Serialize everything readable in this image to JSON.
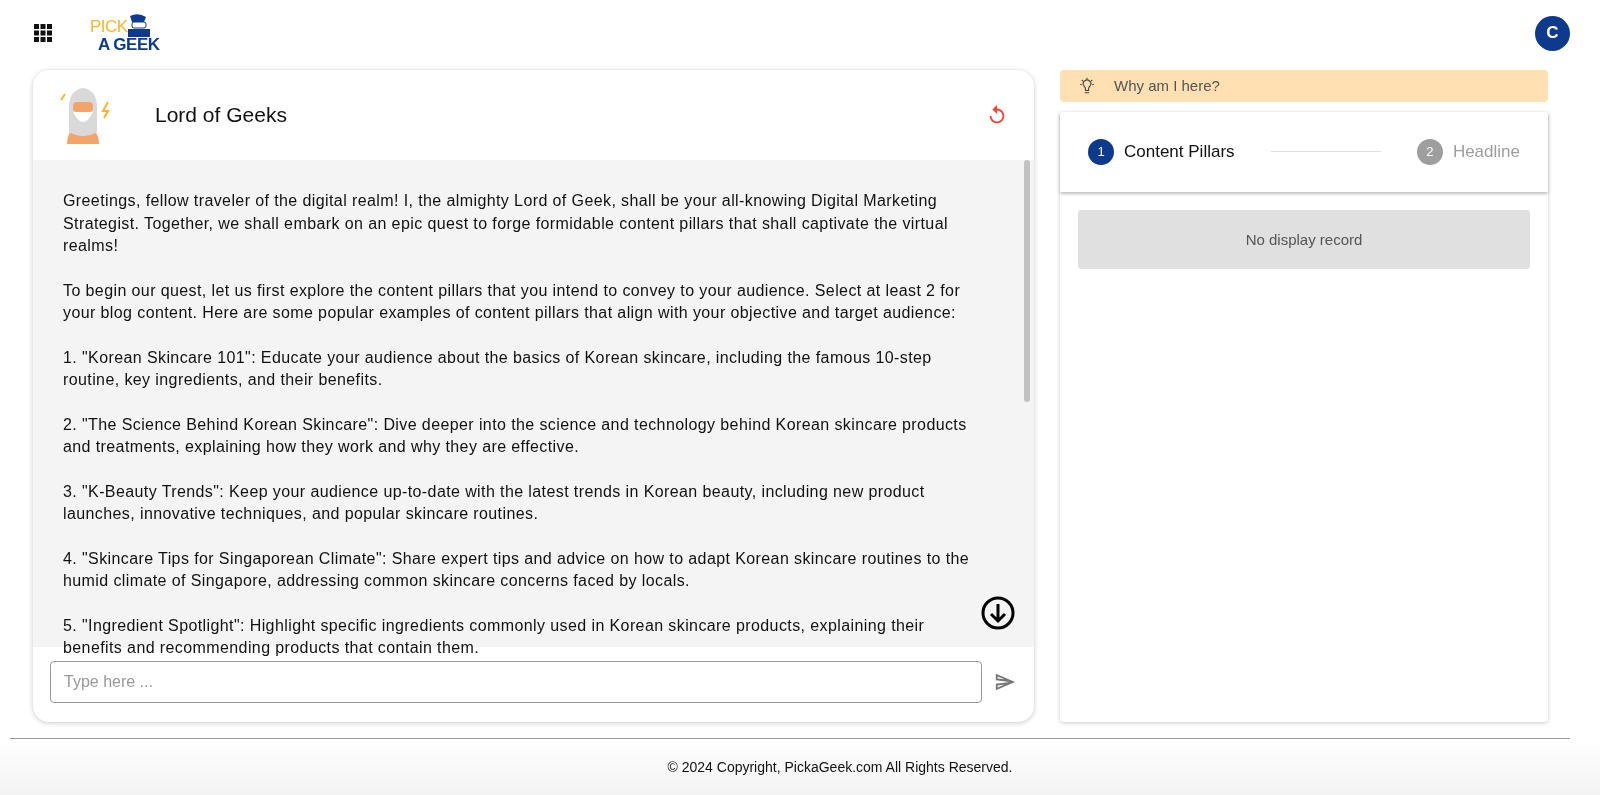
{
  "header": {
    "logo": {
      "line1": "PICK",
      "line2": "A GEEK"
    },
    "avatar": "C"
  },
  "chat": {
    "title": "Lord of Geeks",
    "messages": [
      "Greetings, fellow traveler of the digital realm! I, the almighty Lord of Geek, shall be your all-knowing Digital Marketing Strategist. Together, we shall embark on an epic quest to forge formidable content pillars that shall captivate the virtual realms!",
      "To begin our quest, let us first explore the content pillars that you intend to convey to your audience. Select at least 2 for your blog content. Here are some popular examples of content pillars that align with your objective and target audience:",
      "1. \"Korean Skincare 101\": Educate your audience about the basics of Korean skincare, including the famous 10-step routine, key ingredients, and their benefits.",
      "2. \"The Science Behind Korean Skincare\": Dive deeper into the science and technology behind Korean skincare products and treatments, explaining how they work and why they are effective.",
      "3. \"K-Beauty Trends\": Keep your audience up-to-date with the latest trends in Korean beauty, including new product launches, innovative techniques, and popular skincare routines.",
      "4. \"Skincare Tips for Singaporean Climate\": Share expert tips and advice on how to adapt Korean skincare routines to the humid climate of Singapore, addressing common skincare concerns faced by locals.",
      "5. \"Ingredient Spotlight\": Highlight specific ingredients commonly used in Korean skincare products, explaining their benefits and recommending products that contain them."
    ],
    "input": {
      "placeholder": "Type here ..."
    }
  },
  "help_banner": "Why am I here?",
  "stepper": [
    {
      "number": "1",
      "label": "Content Pillars",
      "selected": true
    },
    {
      "number": "2",
      "label": "Headline",
      "selected": false
    }
  ],
  "empty_state": "No display record",
  "footer": "© 2024 Copyright, PickaGeek.com All Rights Reserved."
}
